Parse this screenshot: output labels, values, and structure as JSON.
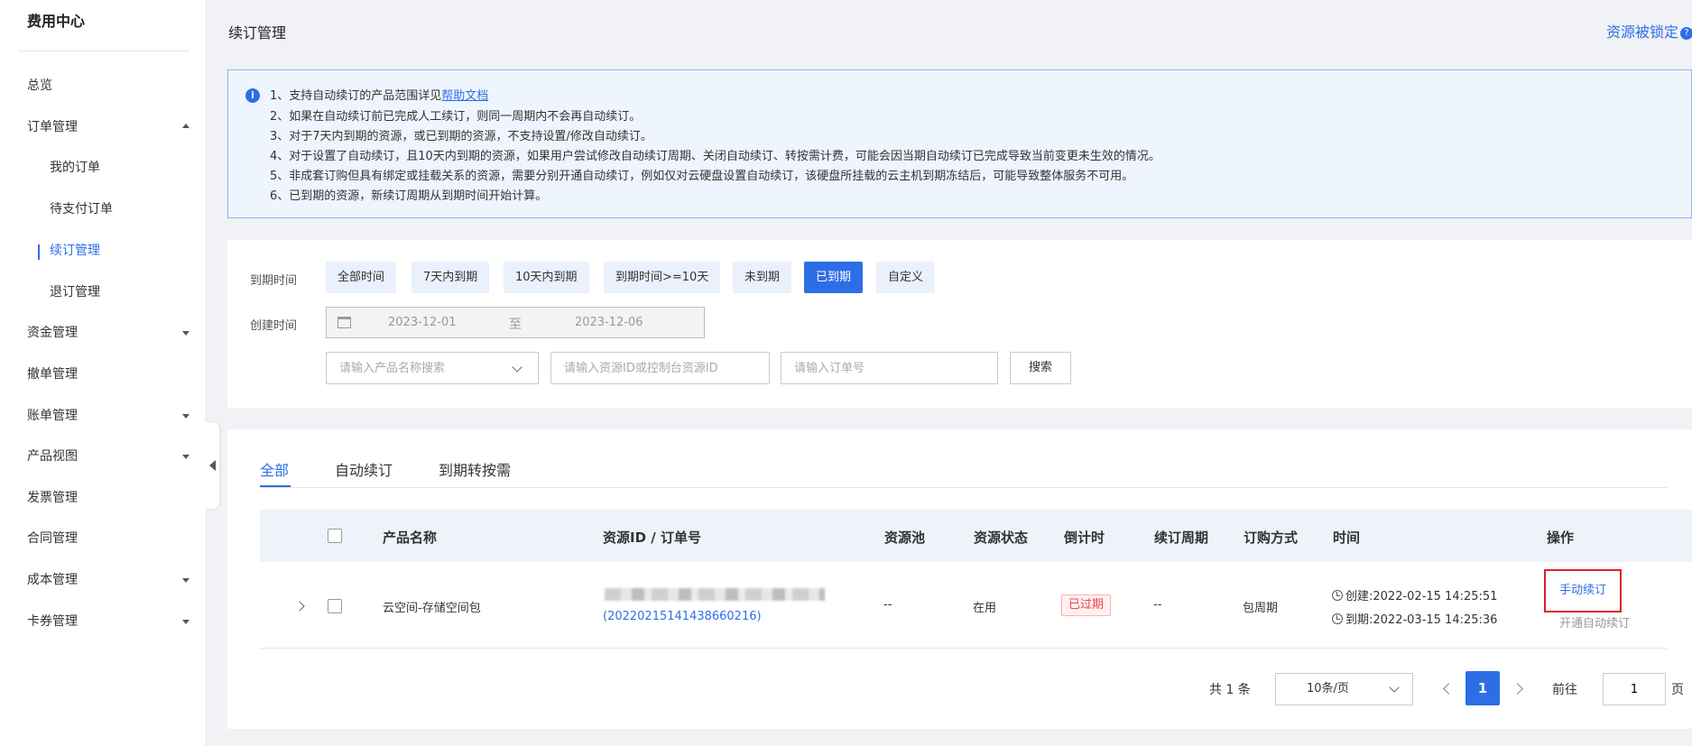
{
  "sidebar": {
    "title": "费用中心",
    "items": [
      {
        "label": "总览"
      },
      {
        "label": "订单管理"
      },
      {
        "label": "资金管理"
      },
      {
        "label": "撤单管理"
      },
      {
        "label": "账单管理"
      },
      {
        "label": "产品视图"
      },
      {
        "label": "发票管理"
      },
      {
        "label": "合同管理"
      },
      {
        "label": "成本管理"
      },
      {
        "label": "卡券管理"
      }
    ],
    "order_sub": [
      {
        "label": "我的订单"
      },
      {
        "label": "待支付订单"
      },
      {
        "label": "续订管理"
      },
      {
        "label": "退订管理"
      }
    ]
  },
  "header": {
    "title": "续订管理",
    "locked_link": "资源被锁定",
    "help_glyph": "?"
  },
  "notice": {
    "icon_glyph": "i",
    "line1_prefix": "1、支持自动续订的产品范围详见",
    "line1_link": "帮助文档",
    "lines": [
      "2、如果在自动续订前已完成人工续订，则同一周期内不会再自动续订。",
      "3、对于7天内到期的资源，或已到期的资源，不支持设置/修改自动续订。",
      "4、对于设置了自动续订，且10天内到期的资源，如果用户尝试修改自动续订周期、关闭自动续订、转按需计费，可能会因当期自动续订已完成导致当前变更未生效的情况。",
      "5、非成套订购但具有绑定或挂载关系的资源，需要分别开通自动续订，例如仅对云硬盘设置自动续订，该硬盘所挂载的云主机到期冻结后，可能导致整体服务不可用。",
      "6、已到期的资源，新续订周期从到期时间开始计算。"
    ]
  },
  "filters": {
    "expire_label": "到期时间",
    "create_label": "创建时间",
    "chips": [
      {
        "label": "全部时间"
      },
      {
        "label": "7天内到期"
      },
      {
        "label": "10天内到期"
      },
      {
        "label": "到期时间>=10天"
      },
      {
        "label": "未到期"
      },
      {
        "label": "已到期"
      },
      {
        "label": "自定义"
      }
    ],
    "active_chip": "已到期",
    "date_start": "2023-12-01",
    "date_sep": "至",
    "date_end": "2023-12-06",
    "product_placeholder": "请输入产品名称搜索",
    "resource_placeholder": "请输入资源ID或控制台资源ID",
    "order_placeholder": "请输入订单号",
    "search_label": "搜索"
  },
  "tabs": [
    {
      "label": "全部"
    },
    {
      "label": "自动续订"
    },
    {
      "label": "到期转按需"
    }
  ],
  "table": {
    "headers": [
      "产品名称",
      "资源ID / 订单号",
      "资源池",
      "资源状态",
      "倒计时",
      "续订周期",
      "订购方式",
      "时间",
      "操作"
    ],
    "rows": [
      {
        "product": "云空间-存储空间包",
        "order_id": "(20220215141438660216)",
        "pool": "--",
        "status": "在用",
        "countdown": "已过期",
        "cycle": "--",
        "method": "包周期",
        "created": "创建:2022-02-15 14:25:51",
        "expires": "到期:2022-03-15 14:25:36",
        "action_primary": "手动续订",
        "action_secondary": "开通自动续订"
      }
    ]
  },
  "pagination": {
    "total": "共 1 条",
    "page_size": "10条/页",
    "current": "1",
    "goto_label": "前往",
    "goto_value": "1",
    "page_suffix": "页"
  },
  "colors": {
    "accent": "#2d6ee6",
    "danger": "#e84545",
    "highlight_border": "#e02020"
  }
}
